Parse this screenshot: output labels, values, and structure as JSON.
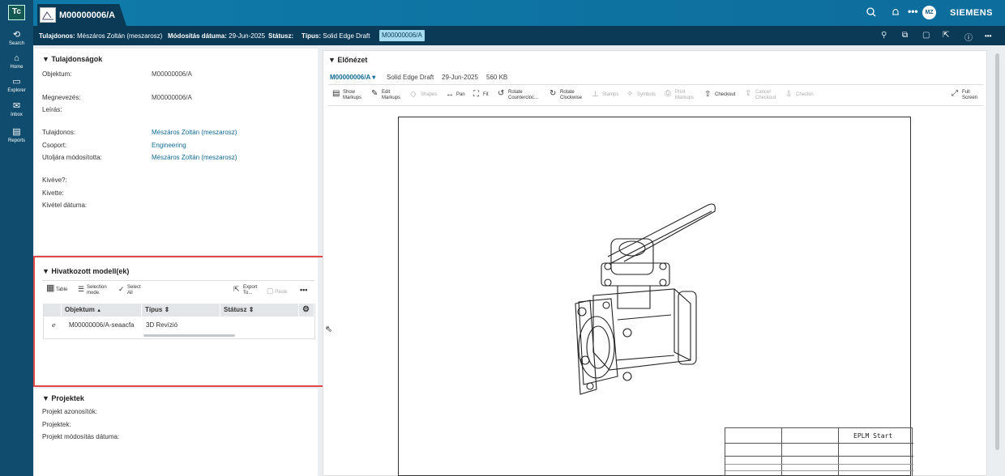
{
  "nav": {
    "logo": "Tc",
    "items": [
      {
        "label": "Search",
        "icon": "⟲"
      },
      {
        "label": "Home",
        "icon": "⌂"
      },
      {
        "label": "Explorer",
        "icon": "▭"
      },
      {
        "label": "Inbox",
        "icon": "✉"
      },
      {
        "label": "Reports",
        "icon": "▤"
      }
    ]
  },
  "topbar": {
    "tab_title": "M00000006/A",
    "avatar": "MZ",
    "brand": "SIEMENS",
    "icons": [
      "search-icon",
      "bell-icon",
      "more-icon"
    ]
  },
  "subbar": {
    "owner_label": "Tulajdonos:",
    "owner_value": "Mészáros Zoltán (meszarosz)",
    "mod_label": "Módosítás dátuma:",
    "mod_value": "29-Jun-2025",
    "status_label": "Státusz:",
    "type_label": "Típus:",
    "type_value": "Solid Edge Draft",
    "chip": "M00000006/A"
  },
  "props": {
    "title": "▼ Tulajdonságok",
    "rows": [
      {
        "label": "Objektum:",
        "value": "M00000006/A"
      },
      {
        "label": "Megnevezés:",
        "value": "M00000006/A"
      },
      {
        "label": "Leírás:",
        "value": ""
      },
      {
        "label": "Tulajdonos:",
        "value": "Mészáros Zoltán (meszarosz)"
      },
      {
        "label": "Csoport:",
        "value": "Engineering"
      },
      {
        "label": "Utoljára módosította:",
        "value": "Mészáros Zoltán (meszarosz)"
      },
      {
        "label": "Kivéve?:",
        "value": ""
      },
      {
        "label": "Kivette:",
        "value": ""
      },
      {
        "label": "Kivétel dátuma:",
        "value": ""
      }
    ]
  },
  "models": {
    "title": "▼ Hivatkozott modell(ek)",
    "toolbar": {
      "table": "Table",
      "selection1": "Selection",
      "selection2": "mode.",
      "select1": "Select",
      "select2": "All",
      "export1": "Export",
      "export2": "To...",
      "paste": "Paste",
      "more": "•••"
    },
    "columns": [
      "Objektum",
      "Típus",
      "Státusz"
    ],
    "sort_asc": "▲",
    "sort_both": "⇕",
    "row": {
      "icon": "ℯ",
      "obj": "M00000006/A-seaacfa",
      "type": "3D Revízió",
      "status": ""
    }
  },
  "projects": {
    "title": "▼ Projektek",
    "rows": [
      "Projekt azonosítók:",
      "Projektek:",
      "Projekt módosítás dátuma:"
    ]
  },
  "preview": {
    "title": "▼ Előnézet",
    "file": "M00000006/A",
    "file_caret": "▾",
    "type": "Solid Edge Draft",
    "date": "29-Jun-2025",
    "size": "560 KB",
    "toolbar": {
      "show1": "Show",
      "show2": "Markups",
      "edit1": "Edit",
      "edit2": "Markups",
      "shapes": "Shapes",
      "pan": "Pan",
      "fit": "Fit",
      "rotccw1": "Rotate",
      "rotccw2": "Counterclоc...",
      "rotcw1": "Rotate",
      "rotcw2": "Clockwise",
      "stamps": "Stamps",
      "symbols": "Symbols",
      "print1": "Print",
      "print2": "Markups",
      "checkout": "Checkout",
      "cancel1": "Cancel",
      "cancel2": "Checkout",
      "checkin": "Checkin",
      "full1": "Full",
      "full2": "Screen"
    },
    "titleblock": {
      "company": "EPLM Start"
    }
  }
}
